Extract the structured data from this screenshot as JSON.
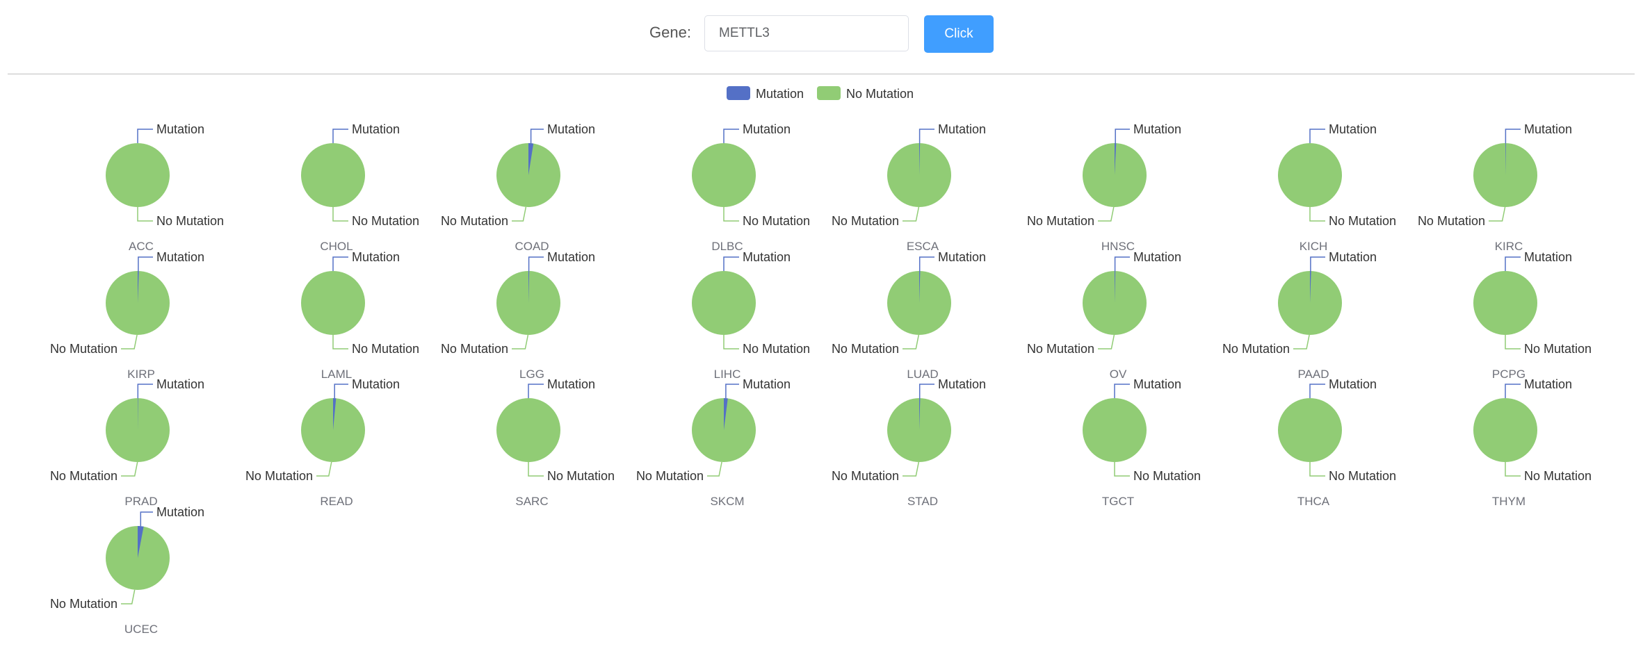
{
  "query": {
    "gene_label": "Gene:",
    "gene_value": "METTL3",
    "button_label": "Click"
  },
  "colors": {
    "mutation": "#5470c6",
    "no_mutation": "#91cc75"
  },
  "chart_data": {
    "type": "pie",
    "legend": {
      "position": "top-center",
      "entries": [
        "Mutation",
        "No Mutation"
      ]
    },
    "label_mutation": "Mutation",
    "label_no_mutation": "No Mutation",
    "charts": [
      {
        "cancer": "ACC",
        "mutation_fraction": 0.0
      },
      {
        "cancer": "CHOL",
        "mutation_fraction": 0.0
      },
      {
        "cancer": "COAD",
        "mutation_fraction": 0.025
      },
      {
        "cancer": "DLBC",
        "mutation_fraction": 0.0
      },
      {
        "cancer": "ESCA",
        "mutation_fraction": 0.004
      },
      {
        "cancer": "HNSC",
        "mutation_fraction": 0.008
      },
      {
        "cancer": "KICH",
        "mutation_fraction": 0.0
      },
      {
        "cancer": "KIRC",
        "mutation_fraction": 0.003
      },
      {
        "cancer": "KIRP",
        "mutation_fraction": 0.006
      },
      {
        "cancer": "LAML",
        "mutation_fraction": 0.0
      },
      {
        "cancer": "LGG",
        "mutation_fraction": 0.004
      },
      {
        "cancer": "LIHC",
        "mutation_fraction": 0.0
      },
      {
        "cancer": "LUAD",
        "mutation_fraction": 0.005
      },
      {
        "cancer": "OV",
        "mutation_fraction": 0.004
      },
      {
        "cancer": "PAAD",
        "mutation_fraction": 0.006
      },
      {
        "cancer": "PCPG",
        "mutation_fraction": 0.0
      },
      {
        "cancer": "PRAD",
        "mutation_fraction": 0.002
      },
      {
        "cancer": "READ",
        "mutation_fraction": 0.015
      },
      {
        "cancer": "SARC",
        "mutation_fraction": 0.0
      },
      {
        "cancer": "SKCM",
        "mutation_fraction": 0.02
      },
      {
        "cancer": "STAD",
        "mutation_fraction": 0.005
      },
      {
        "cancer": "TGCT",
        "mutation_fraction": 0.0
      },
      {
        "cancer": "THCA",
        "mutation_fraction": 0.0
      },
      {
        "cancer": "THYM",
        "mutation_fraction": 0.0
      },
      {
        "cancer": "UCEC",
        "mutation_fraction": 0.03
      }
    ]
  }
}
